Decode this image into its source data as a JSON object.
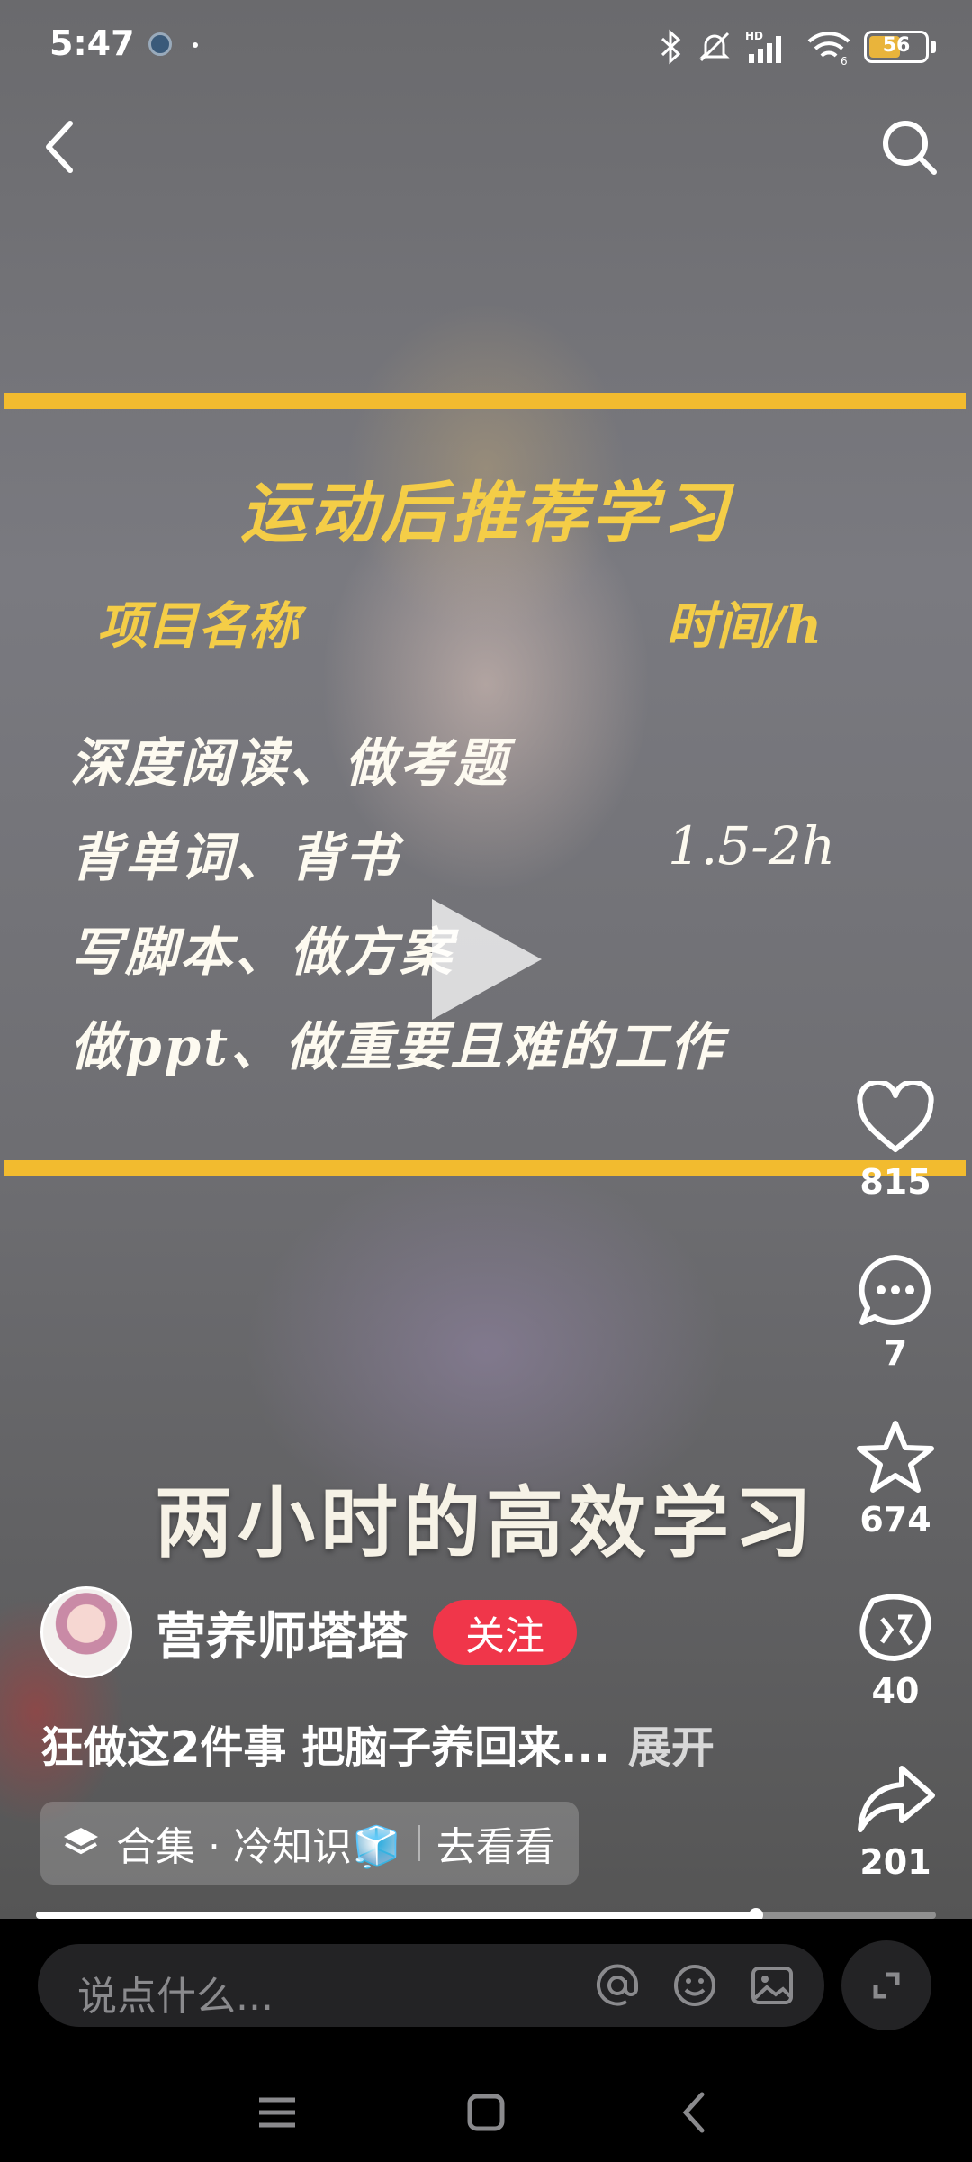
{
  "status_bar": {
    "time": "5:47",
    "battery": "56",
    "battery_level": 0.56
  },
  "video_overlay": {
    "title": "运动后推荐学习",
    "column_left": "项目名称",
    "column_right": "时间/h",
    "rows": [
      "深度阅读、做考题",
      "背单词、背书",
      "写脚本、做方案",
      "做ppt、做重要且难的工作"
    ],
    "row_time": "1.5-2h",
    "caption": "两小时的高效学习"
  },
  "actions": {
    "likes": "815",
    "comments": "7",
    "favorites": "674",
    "shares_wechat": "40",
    "shares": "201"
  },
  "author": {
    "name": "营养师塔塔",
    "follow_label": "关注"
  },
  "description": {
    "text": "狂做这2件事 把脑子养回来...",
    "expand_label": "展开"
  },
  "collection": {
    "label": "合集 · 冷知识🧊",
    "go_label": "去看看"
  },
  "progress": {
    "fraction": 0.8
  },
  "comment_input": {
    "placeholder": "说点什么..."
  },
  "icons": [
    "back-icon",
    "search-icon",
    "play-icon",
    "heart-icon",
    "comment-icon",
    "star-icon",
    "wechat-share-icon",
    "share-icon",
    "layers-icon",
    "at-icon",
    "emoji-icon",
    "image-icon",
    "expand-icon",
    "menu-icon",
    "home-icon",
    "nav-back-icon"
  ],
  "colors": {
    "accent_yellow": "#f2bb2f",
    "follow_red": "#f0364a",
    "battery_yellow": "#e9b43b"
  }
}
